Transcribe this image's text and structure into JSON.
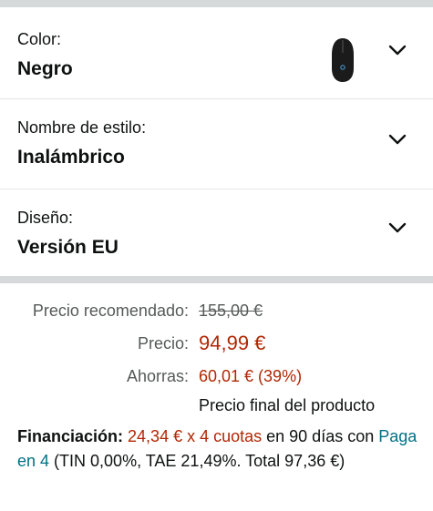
{
  "variants": [
    {
      "label": "Color:",
      "value": "Negro",
      "icon": "chevron-down-icon"
    },
    {
      "label": "Nombre de estilo:",
      "value": "Inalámbrico",
      "icon": "chevron-down-icon"
    },
    {
      "label": "Diseño:",
      "value": "Versión EU",
      "icon": "chevron-down-icon"
    }
  ],
  "thumbnail_icon": "mouse-icon",
  "pricing": {
    "recommended_label": "Precio recomendado:",
    "recommended_value": "155,00 €",
    "price_label": "Precio:",
    "price_value": "94,99 €",
    "savings_label": "Ahorras:",
    "savings_value": "60,01 € (39%)",
    "final_note": "Precio final del producto"
  },
  "financing": {
    "label": "Financiación:",
    "amount": "24,34 € x 4 cuotas",
    "period": " en 90 días con",
    "link": "Paga en 4",
    "terms": " (TIN 0,00%, TAE 21,49%. Total 97,36 €)"
  },
  "colors": {
    "price_red": "#b12704",
    "link_teal": "#007185",
    "separator_gray": "#d5d9d9"
  }
}
